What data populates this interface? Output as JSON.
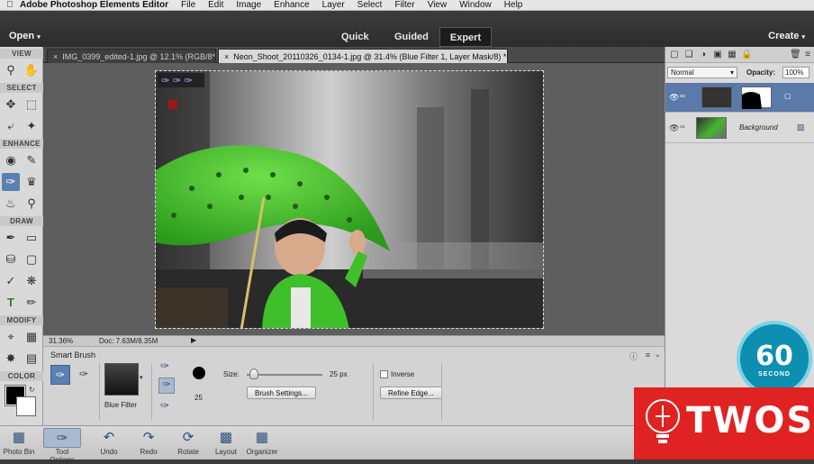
{
  "menubar": {
    "app_name": "Adobe Photoshop Elements Editor",
    "items": [
      "File",
      "Edit",
      "Image",
      "Enhance",
      "Layer",
      "Select",
      "Filter",
      "View",
      "Window",
      "Help"
    ]
  },
  "modebar": {
    "open_label": "Open",
    "modes": [
      "Quick",
      "Guided",
      "Expert"
    ],
    "active_mode": "Expert",
    "create_label": "Create"
  },
  "toolbox": {
    "sections": [
      "VIEW",
      "SELECT",
      "ENHANCE",
      "DRAW",
      "MODIFY",
      "COLOR"
    ]
  },
  "tabs": [
    {
      "label": "IMG_0399_edited-1.jpg @ 12.1% (RGB/8*)",
      "active": false
    },
    {
      "label": "Neon_Shoot_20110326_0134-1.jpg @ 31.4% (Blue Filter 1, Layer Mask/8) *",
      "active": true
    }
  ],
  "status": {
    "zoom": "31.36%",
    "doc": "Doc: 7.63M/8.35M"
  },
  "tool_options": {
    "title": "Smart Brush",
    "preset_label": "Blue Filter",
    "brush_count": "25",
    "size_label": "Size:",
    "size_value": "25 px",
    "size_fraction": 0.1,
    "brush_settings_label": "Brush Settings...",
    "inverse_label": "Inverse",
    "refine_edge_label": "Refine Edge..."
  },
  "layers_panel": {
    "blend_mode": "Normal",
    "opacity_label": "Opacity:",
    "opacity_value": "100%",
    "layers": [
      {
        "name": "",
        "selected": true
      },
      {
        "name": "Background",
        "selected": false
      }
    ]
  },
  "taskbar": {
    "items": [
      {
        "label": "Photo Bin",
        "icon": "photo-bin-icon"
      },
      {
        "label": "Tool Options",
        "icon": "tool-options-icon",
        "active": true
      },
      {
        "label": "Undo",
        "icon": "undo-icon"
      },
      {
        "label": "Redo",
        "icon": "redo-icon"
      },
      {
        "label": "Rotate",
        "icon": "rotate-icon"
      },
      {
        "label": "Layout",
        "icon": "layout-icon"
      },
      {
        "label": "Organizer",
        "icon": "organizer-icon"
      }
    ]
  },
  "badge": {
    "number": "60",
    "text": "SECOND"
  },
  "watermark": {
    "text": "TWOS"
  },
  "colors": {
    "accent": "#5b79a9",
    "umbrella": "#3fbf2a",
    "badge": "#0c8fb0",
    "watermark": "#e02222"
  }
}
